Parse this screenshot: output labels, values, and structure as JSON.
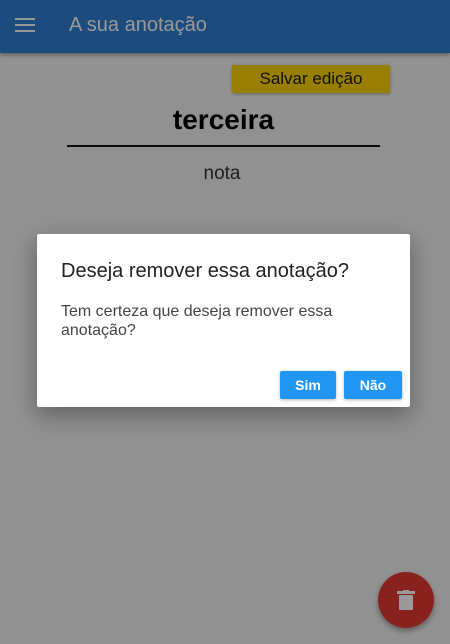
{
  "appbar": {
    "title": "A sua anotação",
    "menu_icon": "menu-icon"
  },
  "editor": {
    "save_label": "Salvar edição",
    "title_value": "terceira",
    "body_value": "nota"
  },
  "fab": {
    "icon": "trash-icon"
  },
  "dialog": {
    "title": "Deseja remover essa anotação?",
    "message": "Tem certeza que deseja remover essa anotação?",
    "yes_label": "Sim",
    "no_label": "Não"
  },
  "colors": {
    "appbar": "#2f7fd1",
    "save_button": "#ffd400",
    "fab": "#e53935",
    "dialog_button": "#2196f3"
  }
}
